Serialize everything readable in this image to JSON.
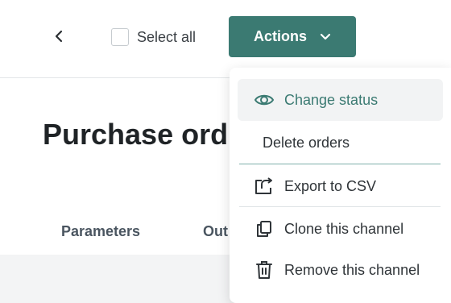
{
  "toolbar": {
    "select_all_label": "Select all",
    "actions_label": "Actions"
  },
  "page": {
    "title": "Purchase ord",
    "tabs": [
      "Parameters",
      "Out"
    ]
  },
  "menu": {
    "items": [
      {
        "label": "Change status",
        "icon": "eye-icon"
      },
      {
        "label": "Delete orders",
        "icon": ""
      },
      {
        "label": "Export to CSV",
        "icon": "export-icon"
      },
      {
        "label": "Clone this channel",
        "icon": "clone-icon"
      },
      {
        "label": "Remove this channel",
        "icon": "trash-icon"
      }
    ]
  },
  "colors": {
    "accent": "#3b7a72",
    "menu_highlight_bg": "#f2f3f4"
  }
}
